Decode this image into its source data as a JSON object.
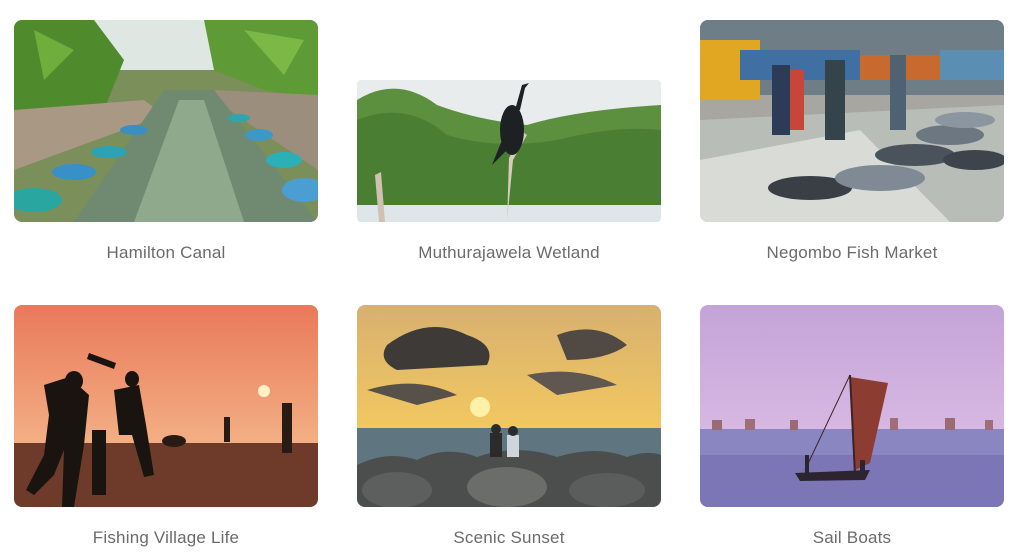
{
  "gallery": {
    "items": [
      {
        "caption": "Hamilton Canal",
        "scene": "canal-with-boats"
      },
      {
        "caption": "Muthurajawela Wetland",
        "scene": "cormorant-bird"
      },
      {
        "caption": "Negombo Fish Market",
        "scene": "fish-market"
      },
      {
        "caption": "Fishing Village Life",
        "scene": "beach-cricket-sunset"
      },
      {
        "caption": "Scenic Sunset",
        "scene": "couple-on-rocks-sunset"
      },
      {
        "caption": "Sail Boats",
        "scene": "oruwa-sail-boat"
      }
    ]
  }
}
